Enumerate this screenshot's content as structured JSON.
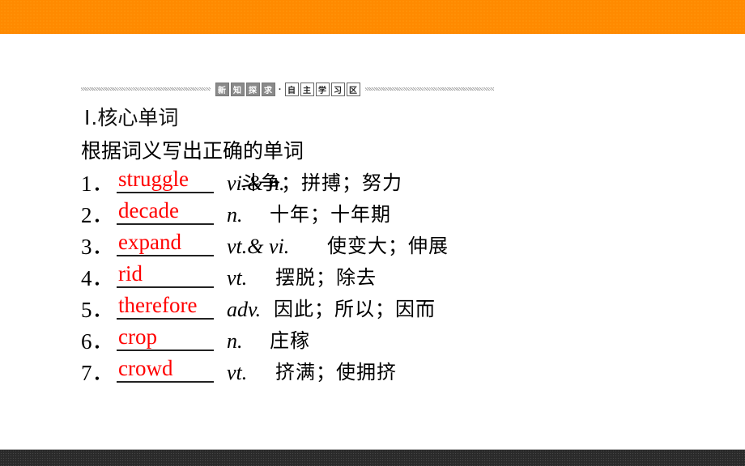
{
  "banner": {
    "tags_dark": [
      "新",
      "知",
      "探",
      "求"
    ],
    "separator": "·",
    "tags_light": [
      "自",
      "主",
      "学",
      "习",
      "区"
    ]
  },
  "section": {
    "roman": "Ⅰ",
    "title": ".核心单词",
    "instruction": "根据词义写出正确的单词"
  },
  "items": [
    {
      "number": "1．",
      "answer": "struggle",
      "pos": "vi.& n.",
      "meaning": "斗争；拼搏；努力"
    },
    {
      "number": "2．",
      "answer": "decade",
      "pos": "n.",
      "meaning": "十年；十年期"
    },
    {
      "number": "3．",
      "answer": "expand",
      "pos": "vt.& vi.",
      "meaning": "使变大；伸展"
    },
    {
      "number": "4．",
      "answer": "rid",
      "pos": "vt.",
      "meaning": "摆脱；除去"
    },
    {
      "number": "5．",
      "answer": "therefore",
      "pos": "adv.",
      "meaning": "因此；所以；因而"
    },
    {
      "number": "6．",
      "answer": "crop",
      "pos": "n.",
      "meaning": "庄稼"
    },
    {
      "number": "7．",
      "answer": "crowd",
      "pos": "vt.",
      "meaning": "挤满；使拥挤"
    }
  ],
  "colors": {
    "top_band": "#ff8a00",
    "bottom_band": "#2a2a2a",
    "answer_text": "#ff0000"
  }
}
